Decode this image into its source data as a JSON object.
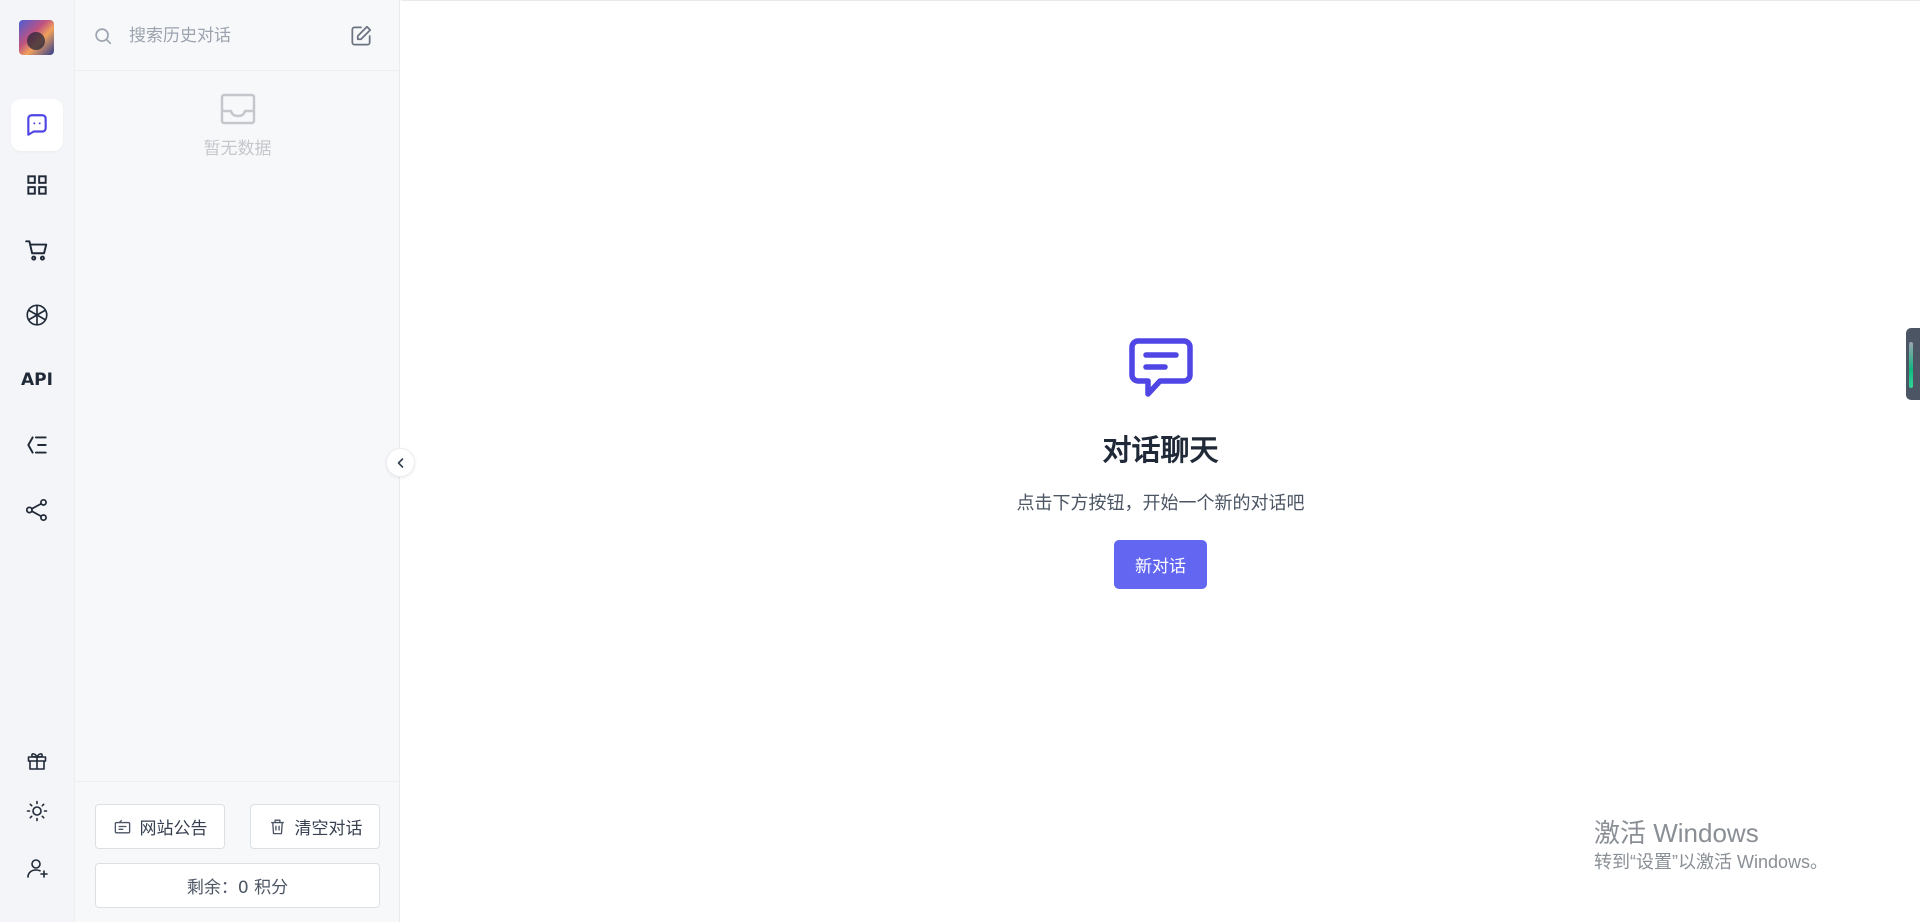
{
  "sidebar_rail": {
    "avatar": "user-avatar",
    "items": [
      {
        "icon": "chat-icon",
        "active": true
      },
      {
        "icon": "apps-grid-icon"
      },
      {
        "icon": "cart-icon"
      },
      {
        "icon": "openai-icon"
      },
      {
        "icon": "api-icon",
        "label": "API"
      },
      {
        "icon": "list-indent-icon"
      },
      {
        "icon": "share-icon"
      }
    ],
    "bottom_items": [
      {
        "icon": "gift-icon"
      },
      {
        "icon": "sun-icon"
      },
      {
        "icon": "user-add-icon"
      }
    ]
  },
  "history_panel": {
    "search_placeholder": "搜索历史对话",
    "empty_text": "暂无数据",
    "notice_label": "网站公告",
    "clear_label": "清空对话",
    "balance_text": "剩余：0 积分"
  },
  "main": {
    "title": "对话聊天",
    "subtitle": "点击下方按钮，开始一个新的对话吧",
    "new_chat_label": "新对话"
  },
  "watermark": {
    "title": "激活 Windows",
    "subtitle": "转到“设置”以激活 Windows。"
  },
  "colors": {
    "accent": "#6366f1",
    "accent_icon": "#4f46e5"
  }
}
